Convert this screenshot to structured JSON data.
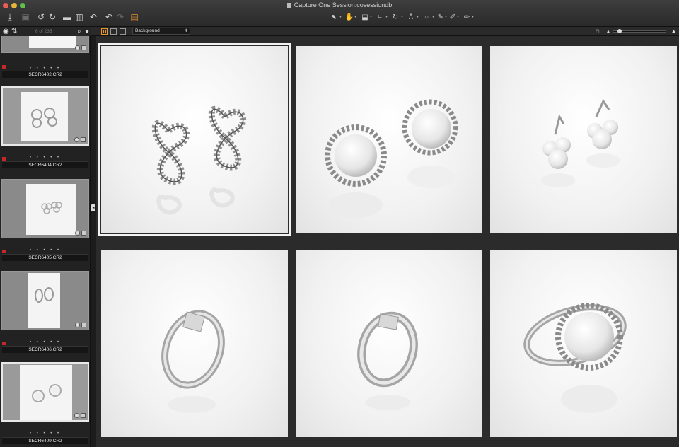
{
  "window": {
    "title": "Capture One Session.cosessiondb"
  },
  "toolbar": {
    "left_icons": [
      "import-icon",
      "camera-icon",
      "rotate-left-icon",
      "rotate-right-icon",
      "folder-icon",
      "trash-icon",
      "undo-icon",
      "undo-icon",
      "redo-icon",
      "edit-stack-icon"
    ],
    "cursor_tools": [
      "select-icon",
      "hand-icon",
      "loupe-icon",
      "crop-icon",
      "rotate-icon",
      "keystone-icon",
      "spot-icon",
      "picker-icon",
      "brush-icon",
      "eraser-icon"
    ],
    "accent_color": "#e8962f"
  },
  "browser": {
    "count_label": "6 of 235",
    "view_select_value": "Background",
    "zoom_label": "Fit"
  },
  "filmstrip": {
    "items": [
      {
        "name": "SECR6402.CR2",
        "stars": "• • • • •",
        "color_tag": "#c62828",
        "selected": false
      },
      {
        "name": "SECR6404.CR2",
        "stars": "• • • • •",
        "color_tag": "#c62828",
        "selected": true
      },
      {
        "name": "SECR6405.CR2",
        "stars": "• • • • •",
        "color_tag": "#c62828",
        "selected": false
      },
      {
        "name": "SECR6406.CR2",
        "stars": "• • • • •",
        "color_tag": "#c62828",
        "selected": false
      },
      {
        "name": "SECR6409.CR2",
        "stars": "• • • • •",
        "color_tag": "#c62828",
        "selected": true
      }
    ]
  },
  "viewer": {
    "tiles": [
      {
        "subject": "infinity-earrings",
        "selected": true
      },
      {
        "subject": "pearl-halo-earrings",
        "selected": false
      },
      {
        "subject": "pearl-cluster-earrings",
        "selected": false
      },
      {
        "subject": "diamond-ring",
        "selected": false
      },
      {
        "subject": "diamond-band-ring",
        "selected": false
      },
      {
        "subject": "pearl-halo-ring",
        "selected": false
      }
    ]
  }
}
